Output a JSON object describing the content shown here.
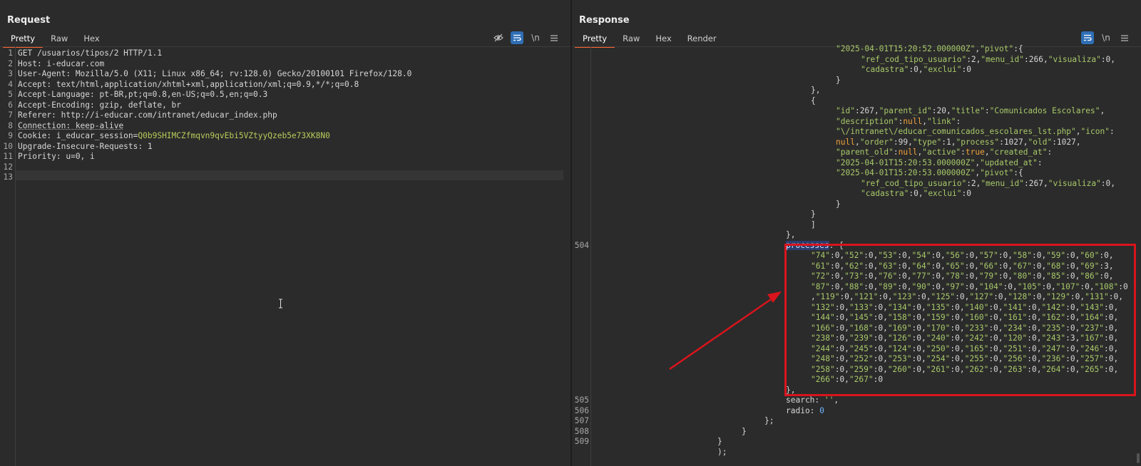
{
  "request": {
    "title": "Request",
    "tabs": [
      "Pretty",
      "Raw",
      "Hex"
    ],
    "active_tab": "Pretty",
    "tools": {
      "hide": "eye-off-icon",
      "wrap": "wrap-icon",
      "newline": "\\n",
      "menu": "menu-icon"
    },
    "lines": [
      {
        "n": "1",
        "text": "GET /usuarios/tipos/2 HTTP/1.1"
      },
      {
        "n": "2",
        "text": "Host: i-educar.com"
      },
      {
        "n": "3",
        "text": "User-Agent: Mozilla/5.0 (X11; Linux x86_64; rv:128.0) Gecko/20100101 Firefox/128.0"
      },
      {
        "n": "4",
        "text": "Accept: text/html,application/xhtml+xml,application/xml;q=0.9,*/*;q=0.8"
      },
      {
        "n": "5",
        "text": "Accept-Language: pt-BR,pt;q=0.8,en-US;q=0.5,en;q=0.3"
      },
      {
        "n": "6",
        "text": "Accept-Encoding: gzip, deflate, br"
      },
      {
        "n": "7",
        "text": "Referer: http://i-educar.com/intranet/educar_index.php"
      },
      {
        "n": "8",
        "text": "Connection: keep-alive"
      },
      {
        "n": "9",
        "text": "Cookie: i_educar_session=",
        "value": "Q0b9SHIMCZfmqvn9qvEbi5VZtyyQzeb5e73XK8N0"
      },
      {
        "n": "10",
        "text": "Upgrade-Insecure-Requests: 1"
      },
      {
        "n": "11",
        "text": "Priority: u=0, i"
      },
      {
        "n": "12",
        "text": ""
      },
      {
        "n": "13",
        "text": ""
      }
    ]
  },
  "response": {
    "title": "Response",
    "tabs": [
      "Pretty",
      "Raw",
      "Hex",
      "Render"
    ],
    "active_tab": "Pretty",
    "tools": {
      "wrap": "wrap-icon",
      "newline": "\\n",
      "menu": "menu-icon"
    },
    "line_numbers": {
      "processes": "504",
      "search": "505",
      "radio": "506",
      "close1": "507",
      "close2": "508",
      "close3": "509"
    },
    "snippets": {
      "created_at_prev": "\"2025-04-01T15:20:52.000000Z\",\"pivot\":{",
      "pivot_prev_1": "\"ref_cod_tipo_usuario\":2,\"menu_id\":266,\"visualiza\":0,",
      "pivot_prev_2": "\"cadastra\":0,\"exclui\":0",
      "item_line_1": "\"id\":267,\"parent_id\":20,\"title\":\"Comunicados Escolares\",",
      "item_line_2": "\"description\":null,\"link\":",
      "item_line_3": "\"\\/intranet\\/educar_comunicados_escolares_lst.php\",\"icon\":",
      "item_line_4": "null,\"order\":99,\"type\":1,\"process\":1027,\"old\":1027,",
      "item_line_5": "\"parent_old\":null,\"active\":true,\"created_at\":",
      "item_line_6": "\"2025-04-01T15:20:53.000000Z\",\"updated_at\":",
      "item_line_7": "\"2025-04-01T15:20:53.000000Z\",\"pivot\":{",
      "pivot_1": "\"ref_cod_tipo_usuario\":2,\"menu_id\":267,\"visualiza\":0,",
      "pivot_2": "\"cadastra\":0,\"exclui\":0",
      "processes_key": "processes",
      "processes_open": ": {",
      "processes_lines": [
        "\"74\":0,\"52\":0,\"53\":0,\"54\":0,\"56\":0,\"57\":0,\"58\":0,\"59\":0,\"60\":0,",
        "\"61\":0,\"62\":0,\"63\":0,\"64\":0,\"65\":0,\"66\":0,\"67\":0,\"68\":0,\"69\":3,",
        "\"72\":0,\"73\":0,\"76\":0,\"77\":0,\"78\":0,\"79\":0,\"80\":0,\"85\":0,\"86\":0,",
        "\"87\":0,\"88\":0,\"89\":0,\"90\":0,\"97\":0,\"104\":0,\"105\":0,\"107\":0,\"108\":0",
        ",\"119\":0,\"121\":0,\"123\":0,\"125\":0,\"127\":0,\"128\":0,\"129\":0,\"131\":0,",
        "\"132\":0,\"133\":0,\"134\":0,\"135\":0,\"140\":0,\"141\":0,\"142\":0,\"143\":0,",
        "\"144\":0,\"145\":0,\"158\":0,\"159\":0,\"160\":0,\"161\":0,\"162\":0,\"164\":0,",
        "\"166\":0,\"168\":0,\"169\":0,\"170\":0,\"233\":0,\"234\":0,\"235\":0,\"237\":0,",
        "\"238\":0,\"239\":0,\"126\":0,\"240\":0,\"242\":0,\"120\":0,\"243\":3,\"167\":0,",
        "\"244\":0,\"245\":0,\"124\":0,\"250\":0,\"165\":0,\"251\":0,\"247\":0,\"246\":0,",
        "\"248\":0,\"252\":0,\"253\":0,\"254\":0,\"255\":0,\"256\":0,\"236\":0,\"257\":0,",
        "\"258\":0,\"259\":0,\"260\":0,\"261\":0,\"262\":0,\"263\":0,\"264\":0,\"265\":0,",
        "\"266\":0,\"267\":0"
      ],
      "search_line": "search: '',",
      "radio_line": "radio: 0"
    }
  },
  "colors": {
    "accent": "#ff6633",
    "annotation": "#d9141c",
    "active_tool": "#2f6fb5"
  }
}
